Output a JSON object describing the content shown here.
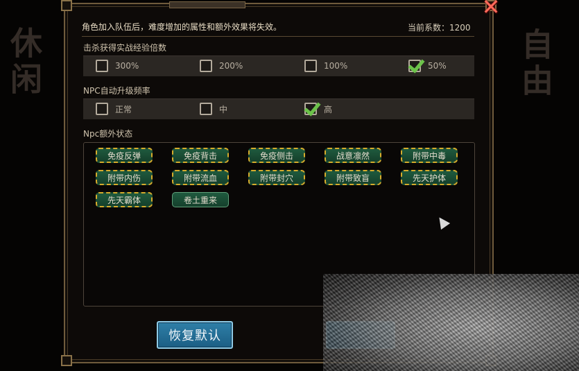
{
  "background": {
    "left_big": "休闲",
    "right_big": "自由"
  },
  "header": {
    "notice": "角色加入队伍后，难度增加的属性和额外效果将失效。",
    "coefficient": "当前系数：1200"
  },
  "exp_section": {
    "label": "击杀获得实战经验倍数",
    "options": [
      {
        "label": "300%",
        "checked": false
      },
      {
        "label": "200%",
        "checked": false
      },
      {
        "label": "100%",
        "checked": false
      },
      {
        "label": "50%",
        "checked": true
      }
    ]
  },
  "npc_level_section": {
    "label": "NPC自动升级频率",
    "options": [
      {
        "label": "正常",
        "checked": false
      },
      {
        "label": "中",
        "checked": false
      },
      {
        "label": "高",
        "checked": true
      }
    ]
  },
  "npc_status_section": {
    "label": "Npc额外状态",
    "tags": [
      {
        "label": "免疫反弹",
        "selected": true
      },
      {
        "label": "免疫背击",
        "selected": true
      },
      {
        "label": "免疫侧击",
        "selected": true
      },
      {
        "label": "战意凛然",
        "selected": true
      },
      {
        "label": "附带中毒",
        "selected": true
      },
      {
        "label": "附带内伤",
        "selected": true
      },
      {
        "label": "附带流血",
        "selected": true
      },
      {
        "label": "附带封穴",
        "selected": true
      },
      {
        "label": "附带致盲",
        "selected": true
      },
      {
        "label": "先天护体",
        "selected": true
      },
      {
        "label": "先天霸体",
        "selected": true
      },
      {
        "label": "卷土重来",
        "selected": false
      }
    ]
  },
  "footer": {
    "restore_label": "恢复默认"
  }
}
